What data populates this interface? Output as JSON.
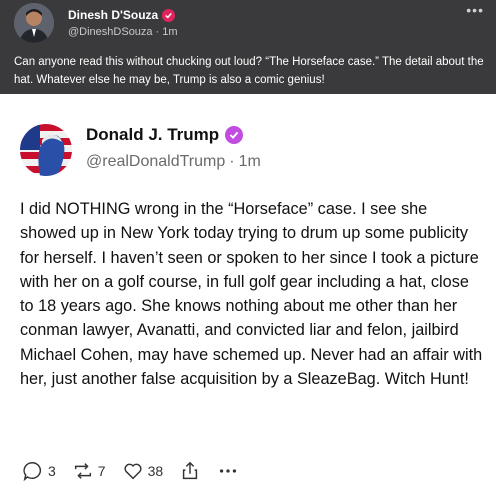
{
  "outer_post": {
    "author_name": "Dinesh D'Souza",
    "handle": "@DineshDSouza",
    "separator": "·",
    "time": "1m",
    "more_icon": "more-horizontal-icon",
    "text": "Can anyone read this without chucking out loud?  “The Horseface case.” The detail about the hat. Whatever else he may be, Trump is also a comic genius!"
  },
  "quoted_post": {
    "author_name": "Donald J. Trump",
    "handle": "@realDonaldTrump",
    "separator": "·",
    "time": "1m",
    "body": "I did NOTHING wrong in the “Horseface” case. I see she showed up in New York today trying to drum up some publicity for herself. I haven’t seen or spoken to her since I took a picture with her on a golf course, in full golf gear including a hat, close to 18 years ago. She knows nothing about me other than her conman lawyer, Avanatti, and convicted liar and felon, jailbird Michael Cohen, may have schemed up. Never had an affair with her, just another false acquisition by a SleazeBag. Witch Hunt!",
    "actions": {
      "reply_count": "3",
      "repost_count": "7",
      "like_count": "38"
    }
  },
  "colors": {
    "outer_background": "#3a3a3c",
    "verified_red": "#e0245e",
    "verified_purple": "#c04de0"
  }
}
